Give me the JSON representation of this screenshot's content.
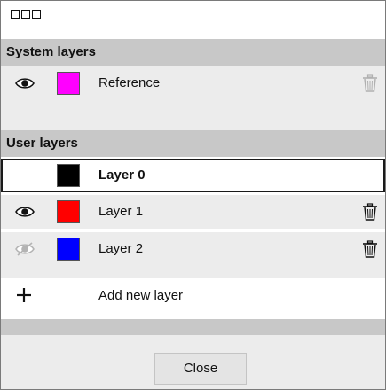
{
  "window": {
    "controls": [
      "window-square",
      "window-square",
      "window-square"
    ]
  },
  "system_section": {
    "title": "System layers"
  },
  "system_layers": [
    {
      "label": "Reference",
      "color": "#ff00ff",
      "visible": true,
      "icons": [
        "eye-icon",
        "trash-icon"
      ],
      "trash_enabled": false
    }
  ],
  "user_section": {
    "title": "User layers"
  },
  "user_layers": [
    {
      "label": "Layer 0",
      "color": "#000000",
      "selected": true,
      "visible": null
    },
    {
      "label": "Layer 1",
      "color": "#ff0000",
      "selected": false,
      "visible": true,
      "icons": [
        "eye-icon",
        "trash-icon"
      ]
    },
    {
      "label": "Layer 2",
      "color": "#0000ff",
      "selected": false,
      "visible": false,
      "icons": [
        "eye-hidden-icon",
        "trash-icon"
      ]
    }
  ],
  "add_layer": {
    "label": "Add new layer",
    "icon": "plus-icon"
  },
  "footer": {
    "close_label": "Close"
  },
  "colors": {
    "section_bg": "#c8c8c8",
    "row_bg": "#ececec",
    "selected_border": "#1a1a1a"
  }
}
